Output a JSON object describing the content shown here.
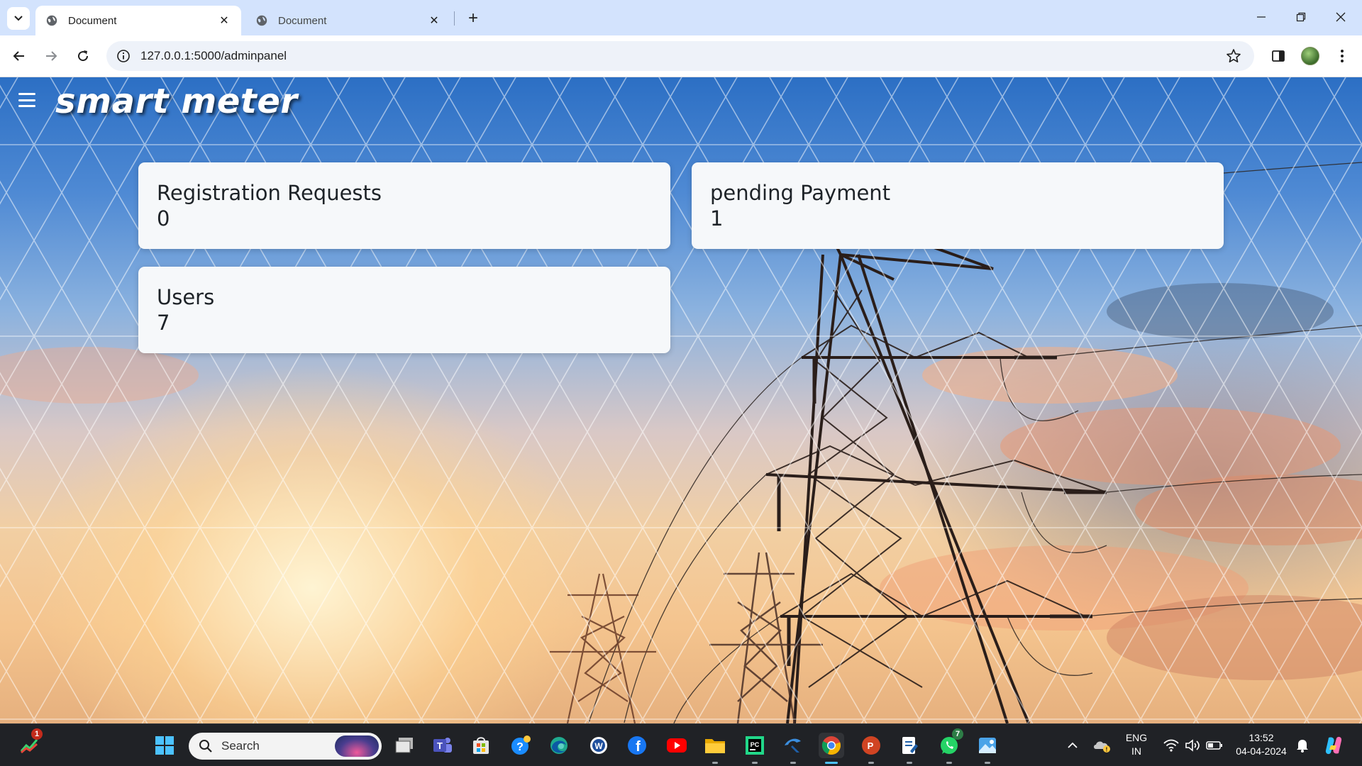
{
  "browser": {
    "tabs": [
      {
        "title": "Document",
        "active": true
      },
      {
        "title": "Document",
        "active": false
      }
    ],
    "url": "127.0.0.1:5000/adminpanel"
  },
  "app": {
    "brand": "smart meter",
    "cards": [
      {
        "title": "Registration Requests",
        "value": "0"
      },
      {
        "title": "pending Payment",
        "value": "1"
      },
      {
        "title": "Users",
        "value": "7"
      }
    ]
  },
  "taskbar": {
    "search_placeholder": "Search",
    "widgets_badge": "1",
    "whatsapp_badge": "7",
    "language": "ENG",
    "region": "IN",
    "time": "13:52",
    "date": "04-04-2024",
    "apps": [
      "start-icon",
      "task-view-icon",
      "teams-icon",
      "store-icon",
      "help-icon",
      "edge-icon",
      "word-icon",
      "facebook-icon",
      "youtube-icon",
      "file-explorer-icon",
      "pycharm-icon",
      "app-arrow-icon",
      "chrome-icon",
      "powerpoint-icon",
      "notepad-icon",
      "whatsapp-icon",
      "photos-icon"
    ],
    "accent": "#4cc2ff"
  }
}
